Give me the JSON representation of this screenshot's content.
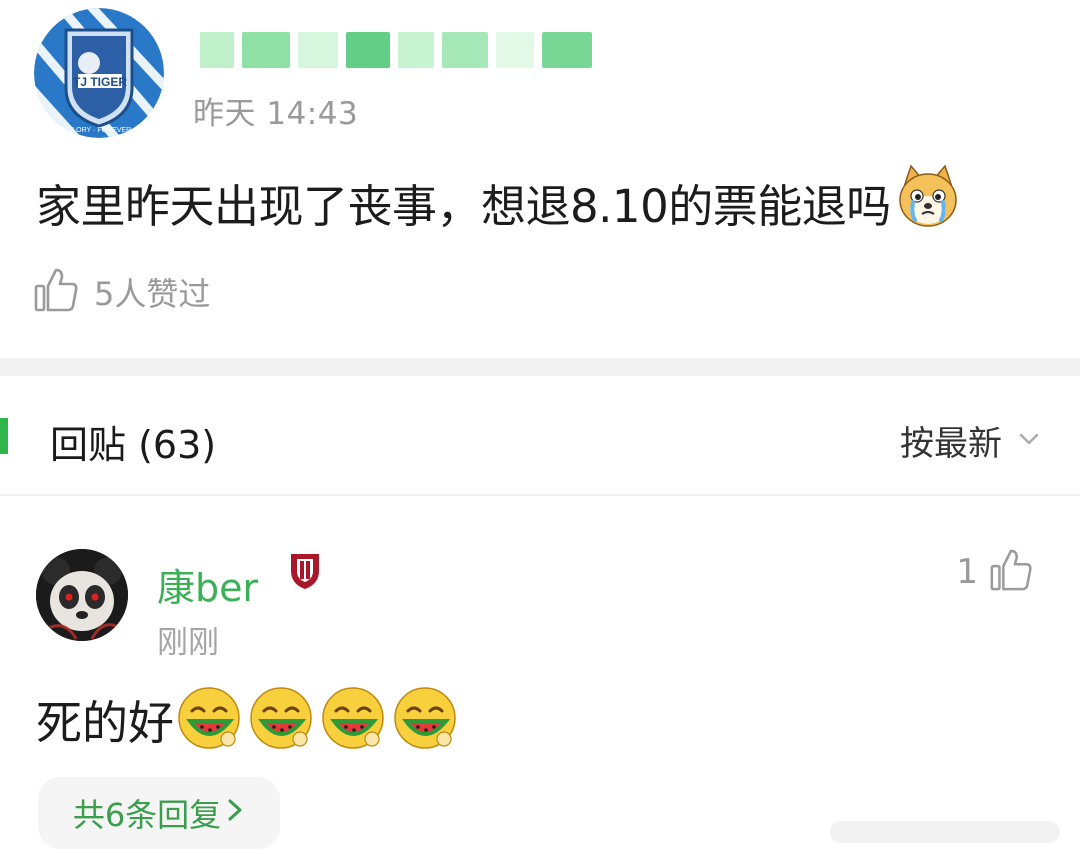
{
  "post": {
    "time": "昨天 14:43",
    "text": "家里昨天出现了丧事，想退8.10的票能退吗",
    "likes": "5人赞过",
    "author_mosaic_colors": [
      "#bff0c9",
      "#8fe0a5",
      "#d6f7dd",
      "#63cf86",
      "#c8f3d1",
      "#a6e8b7",
      "#e1f9e6",
      "#79d795"
    ]
  },
  "replies_header": {
    "title": "回贴 (63)",
    "sort_label": "按最新"
  },
  "comment": {
    "username": "康ber",
    "time": "刚刚",
    "like_count": "1",
    "text": "死的好",
    "emoji_count": 4,
    "more_replies": "共6条回复"
  },
  "icons": {
    "avatar_post": "tiger-team-logo-avatar",
    "avatar_comment": "panda-avatar",
    "thumb": "thumbs-up-icon",
    "sort": "chevron-down-icon",
    "badge": "shield-badge-icon",
    "crying_dog": "crying-shiba-emoji",
    "watermelon": "eating-watermelon-emoji"
  },
  "colors": {
    "accent_green": "#2fb54a",
    "username_green": "#3bb056",
    "secondary_text": "#9a9a9a",
    "badge_red": "#a8182a"
  }
}
